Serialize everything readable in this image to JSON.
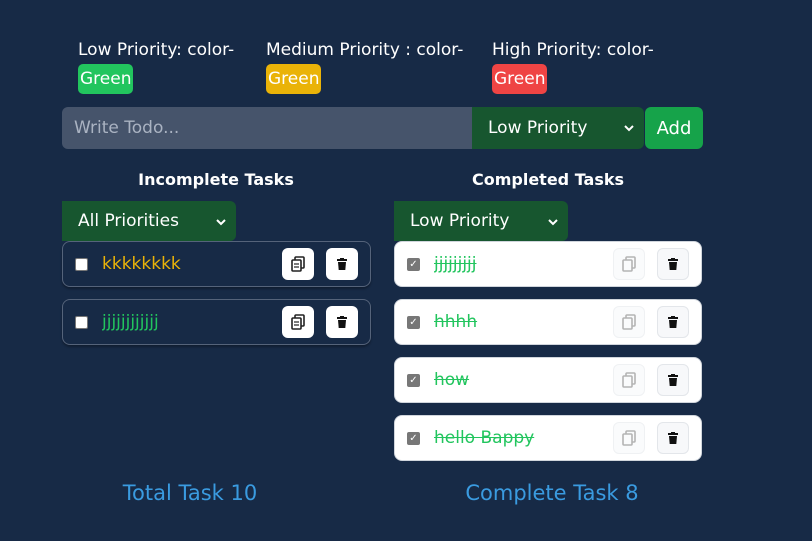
{
  "legend": [
    {
      "label": "Low Priority: color-",
      "swatch": "Green",
      "color": "#22c55e"
    },
    {
      "label": "Medium Priority : color-",
      "swatch": "Green",
      "color": "#eab308"
    },
    {
      "label": "High Priority: color-",
      "swatch": "Green",
      "color": "#ef4444"
    }
  ],
  "form": {
    "placeholder": "Write Todo...",
    "priority_selected": "Low Priority",
    "add_label": "Add"
  },
  "incomplete": {
    "title": "Incomplete Tasks",
    "filter": "All Priorities",
    "tasks": [
      {
        "text": "kkkkkkkk",
        "color": "#eab308"
      },
      {
        "text": "jjjjjjjjjjjj",
        "color": "#22c55e"
      }
    ]
  },
  "completed": {
    "title": "Completed Tasks",
    "filter": "Low Priority",
    "tasks": [
      {
        "text": "jjjjjjjjj"
      },
      {
        "text": "hhhh"
      },
      {
        "text": "how"
      },
      {
        "text": "hello Bappy"
      }
    ]
  },
  "footer": {
    "total": "Total Task 10",
    "complete": "Complete Task 8"
  },
  "colors": {
    "background": "#172a46",
    "accent_green": "#16a34a",
    "select_green": "#17562f",
    "stat_blue": "#3a9be0"
  }
}
